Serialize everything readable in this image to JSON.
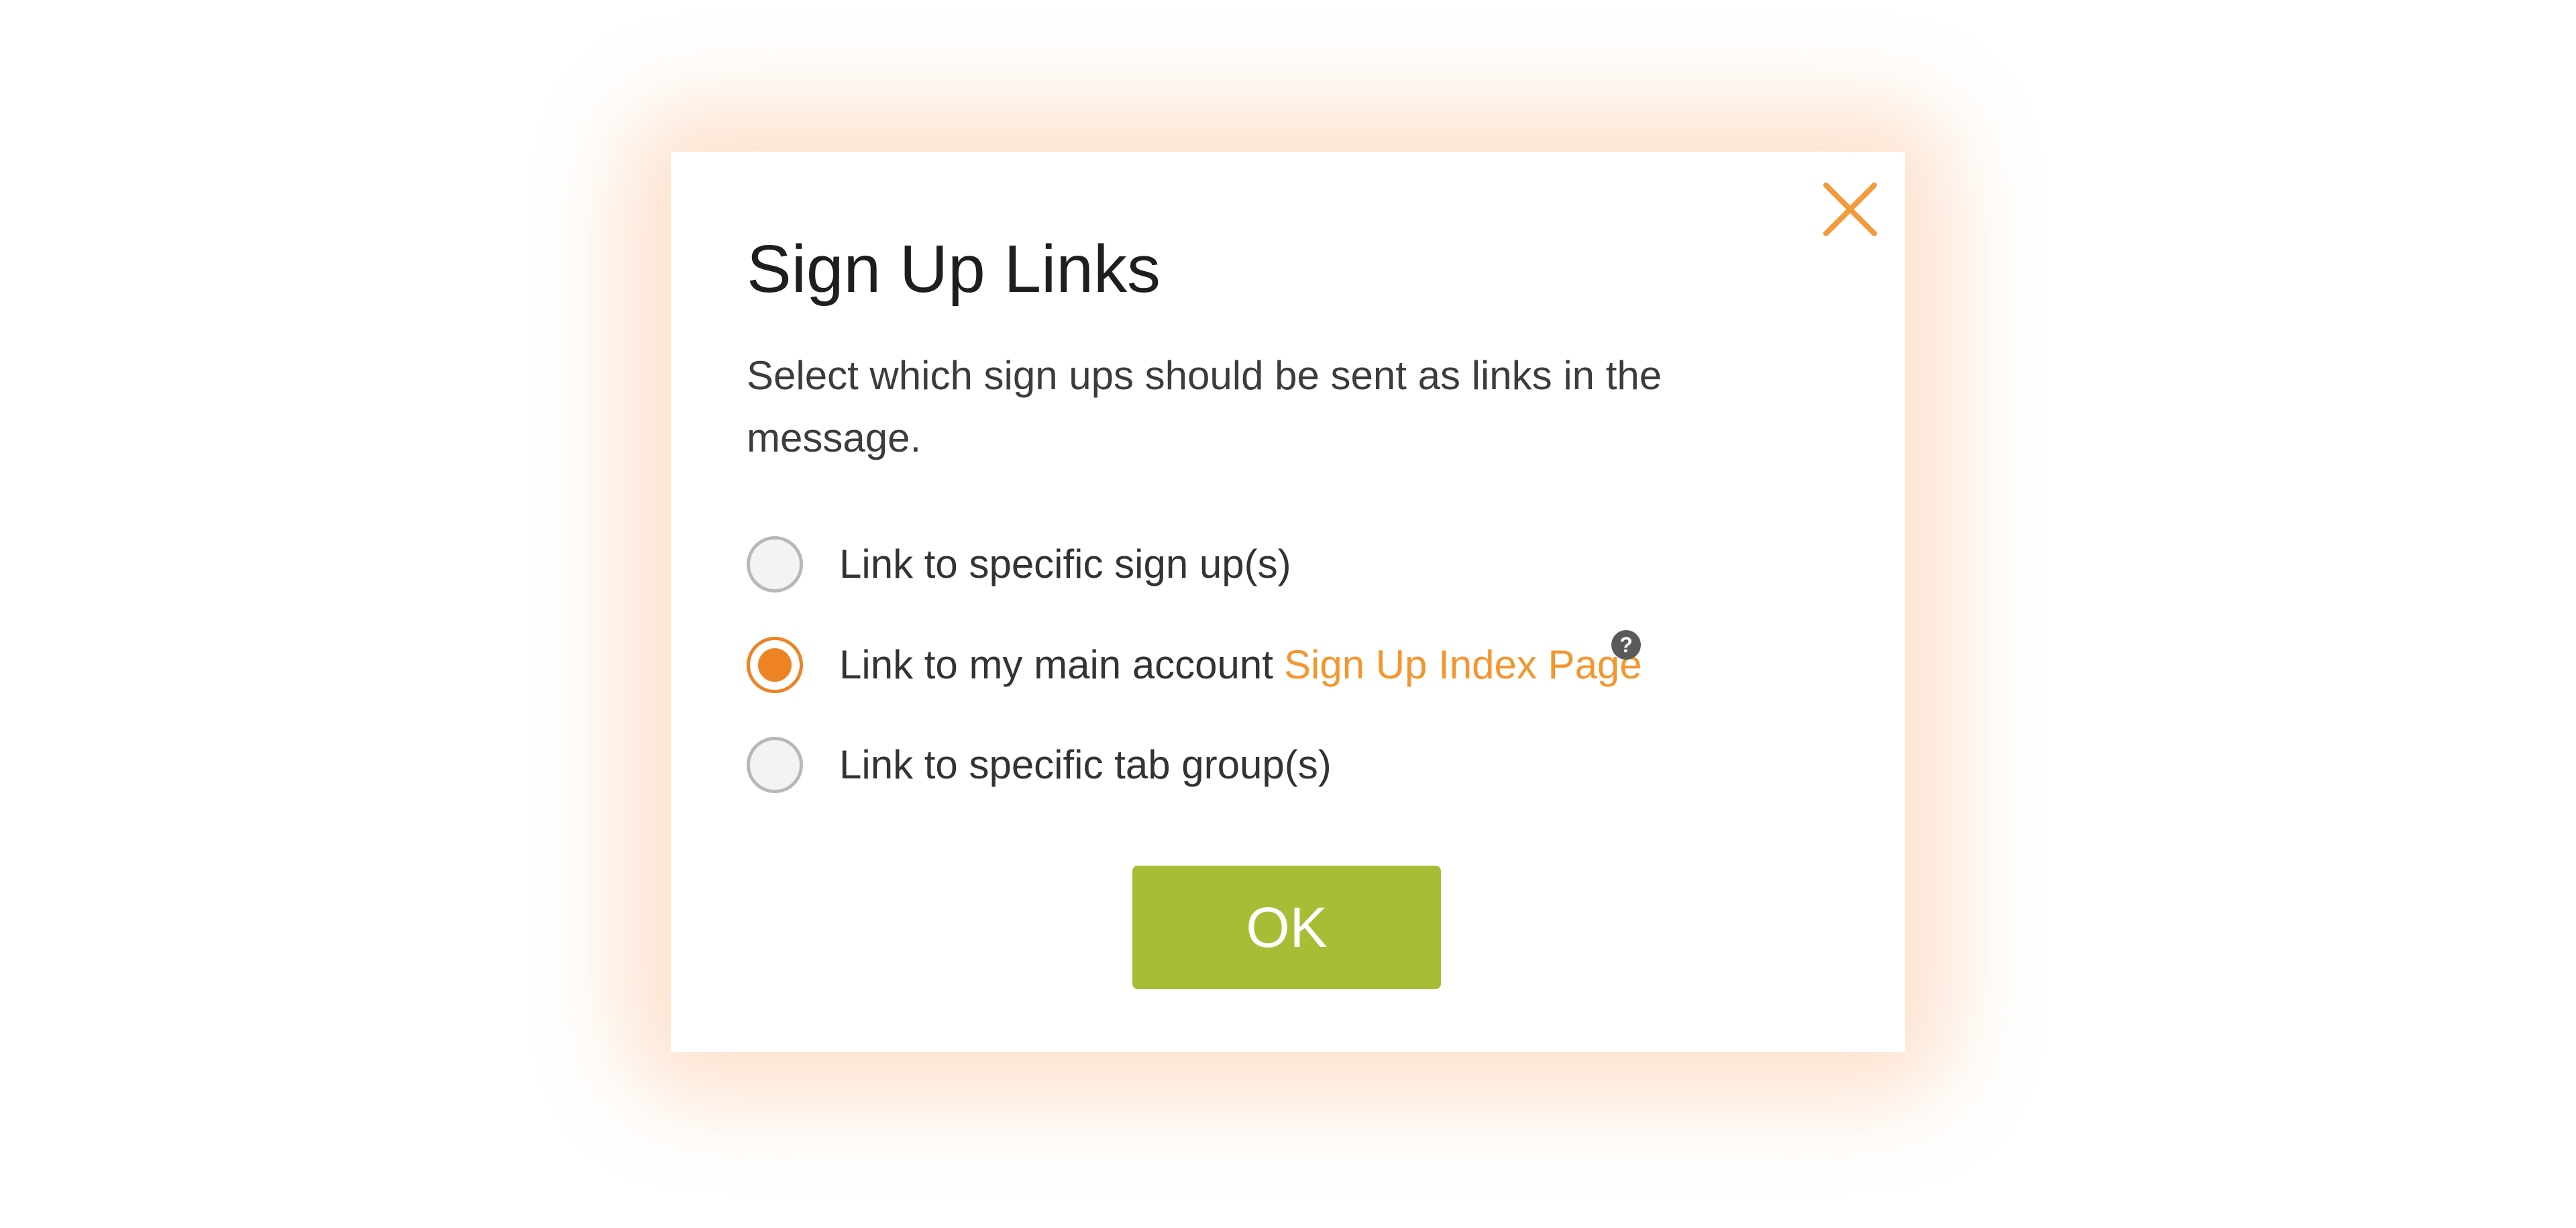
{
  "dialog": {
    "title": "Sign Up Links",
    "description": "Select which sign ups should be sent as links in the message.",
    "close_icon": "close-icon",
    "options": [
      {
        "label": "Link to specific sign up(s)",
        "selected": false
      },
      {
        "label": "Link to my main account",
        "link_text": "Sign Up Index Page",
        "help_icon": "question-mark-icon",
        "help_glyph": "?",
        "selected": true
      },
      {
        "label": "Link to specific tab group(s)",
        "selected": false
      }
    ],
    "ok_label": "OK"
  },
  "colors": {
    "accent": "#ee8324",
    "link": "#f4962e",
    "ok_button": "#a8bd35",
    "glow": "#f9aa6e"
  }
}
